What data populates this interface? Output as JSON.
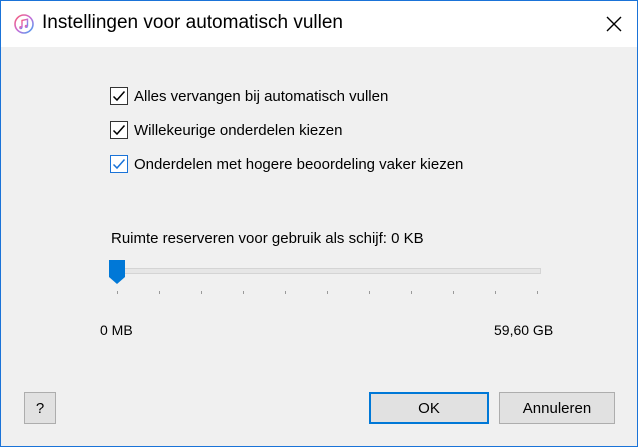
{
  "window": {
    "title": "Instellingen voor automatisch vullen",
    "app_icon": "itunes-music-note-icon",
    "close_icon": "close-icon"
  },
  "options": [
    {
      "label": "Alles vervangen bij automatisch vullen",
      "checked": true
    },
    {
      "label": "Willekeurige onderdelen kiezen",
      "checked": true
    },
    {
      "label": "Onderdelen met hogere beoordeling vaker kiezen",
      "checked": true
    }
  ],
  "reserve": {
    "label": "Ruimte reserveren voor gebruik als schijf: 0 KB",
    "slider_value_fraction": 0,
    "min_label": "0 MB",
    "max_label": "59,60 GB"
  },
  "buttons": {
    "help": "?",
    "ok": "OK",
    "cancel": "Annuleren"
  },
  "colors": {
    "accent": "#0078d7",
    "border": "#1a73d8"
  }
}
